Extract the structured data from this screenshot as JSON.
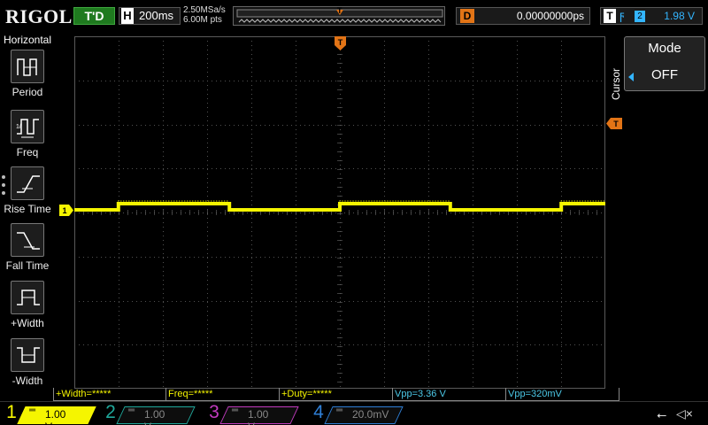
{
  "brand": "RIGOL",
  "top": {
    "run_state": "T'D",
    "timebase_label": "H",
    "timebase_value": "200ms",
    "sample_rate": "2.50MSa/s",
    "memory_depth": "6.00M pts",
    "memory_marker": "T",
    "delay_label": "D",
    "delay_value": "0.00000000ps",
    "trigger_label": "T",
    "trigger_slope_icon": "rising-edge-icon",
    "trigger_source": "2",
    "trigger_level": "1.98 V"
  },
  "left_menu": {
    "title": "Horizontal",
    "items": [
      {
        "label": "Period",
        "icon": "period-icon"
      },
      {
        "label": "Freq",
        "icon": "frequency-icon"
      },
      {
        "label": "Rise Time",
        "icon": "rise-time-icon"
      },
      {
        "label": "Fall Time",
        "icon": "fall-time-icon"
      },
      {
        "label": "+Width",
        "icon": "positive-width-icon"
      },
      {
        "label": "-Width",
        "icon": "negative-width-icon"
      }
    ]
  },
  "markers": {
    "trigger_position": "T",
    "channel1_ground": "1",
    "trigger_level": "T"
  },
  "right_panel": {
    "section": "Cursor",
    "mode_title": "Mode",
    "mode_value": "OFF"
  },
  "measurements": [
    {
      "text": "+Width=*****",
      "color": "#f5f500"
    },
    {
      "text": "Freq=*****",
      "color": "#f5f500"
    },
    {
      "text": "+Duty=*****",
      "color": "#f5f500"
    },
    {
      "text": "Vpp=3.36 V",
      "color": "#4cc9e8"
    },
    {
      "text": "Vpp=320mV",
      "color": "#4cc9e8"
    }
  ],
  "channels": [
    {
      "number": "1",
      "scale": "1.00 V",
      "color": "#f5f500",
      "active": true
    },
    {
      "number": "2",
      "scale": "1.00 V",
      "color": "#1fa89b",
      "active": false
    },
    {
      "number": "3",
      "scale": "1.00 V",
      "color": "#c23bbf",
      "active": false
    },
    {
      "number": "4",
      "scale": "20.0mV",
      "color": "#2f7fd6",
      "active": false
    }
  ],
  "status_icons": [
    "usb-icon",
    "speaker-muted-icon"
  ],
  "colors": {
    "ch1_trace": "#f5f500",
    "grid": "#5a5a5a",
    "trigger_marker": "#e27416",
    "accent_blue": "#33b5ff"
  },
  "waveform": {
    "channel": "1",
    "description_levels": "square wave, low/high",
    "segments": [
      {
        "t0": 0.0,
        "t1": 0.083,
        "level": "low"
      },
      {
        "t0": 0.083,
        "t1": 0.292,
        "level": "high"
      },
      {
        "t0": 0.292,
        "t1": 0.5,
        "level": "low"
      },
      {
        "t0": 0.5,
        "t1": 0.708,
        "level": "high"
      },
      {
        "t0": 0.708,
        "t1": 0.917,
        "level": "low"
      },
      {
        "t0": 0.917,
        "t1": 1.0,
        "level": "high"
      }
    ]
  }
}
